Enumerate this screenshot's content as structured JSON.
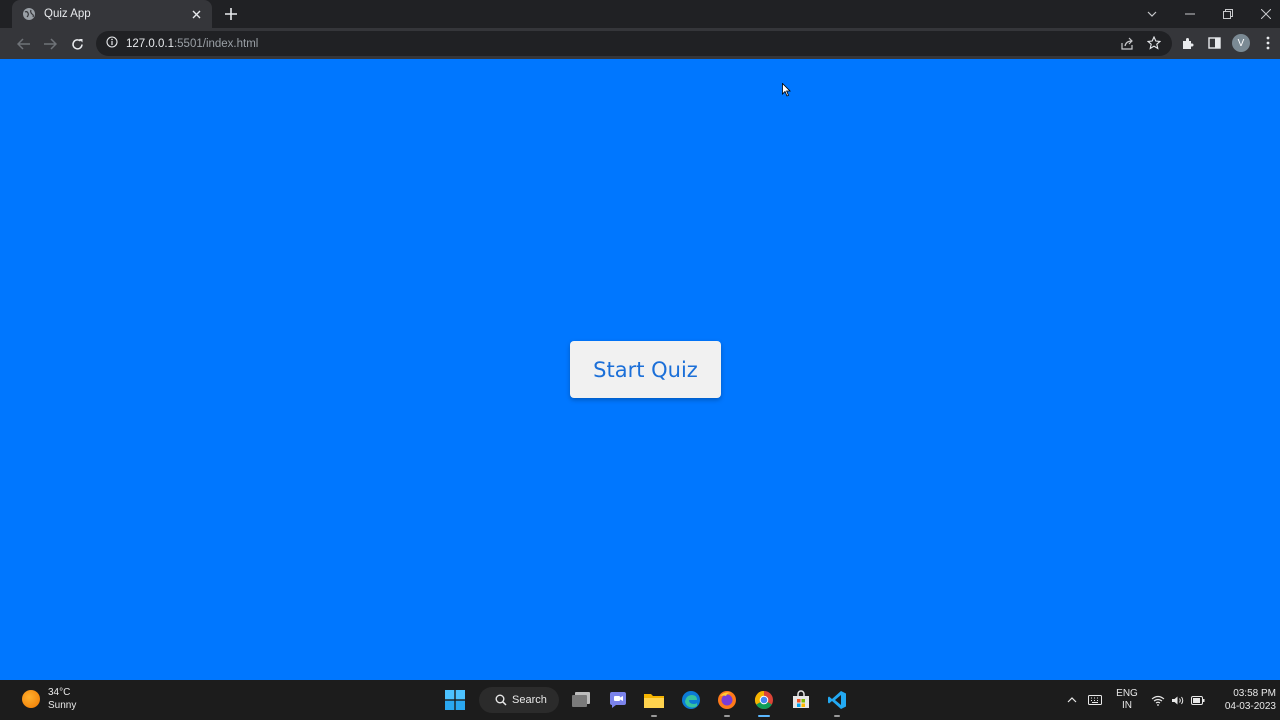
{
  "browser": {
    "tab_title": "Quiz App",
    "url_host": "127.0.0.1",
    "url_path": ":5501/index.html",
    "profile_initial": "V"
  },
  "page": {
    "start_button_label": "Start Quiz",
    "background_color": "#0077ff",
    "button_text_color": "#1b6fd8"
  },
  "taskbar": {
    "weather_temp": "34°C",
    "weather_condition": "Sunny",
    "search_label": "Search",
    "lang_line1": "ENG",
    "lang_line2": "IN",
    "time": "03:58 PM",
    "date": "04-03-2023",
    "apps": [
      "windows-start-icon",
      "task-view-icon",
      "chat-icon",
      "file-explorer-icon",
      "edge-icon",
      "firefox-icon",
      "chrome-icon",
      "store-icon",
      "vscode-icon"
    ]
  }
}
